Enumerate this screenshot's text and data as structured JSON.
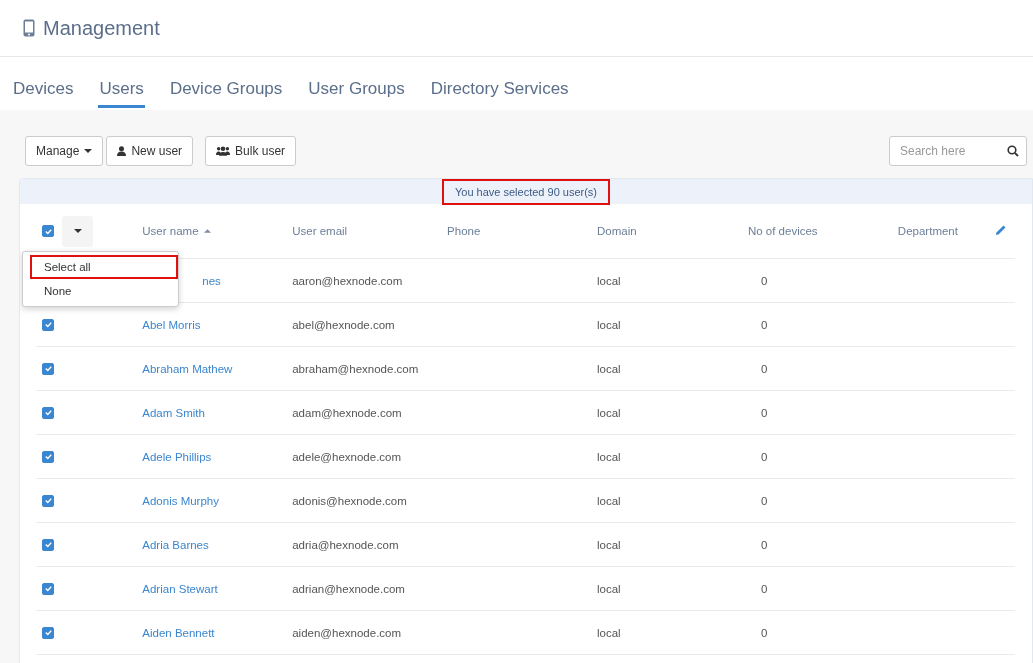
{
  "page": {
    "title": "Management"
  },
  "tabs": [
    {
      "label": "Devices",
      "selected": false
    },
    {
      "label": "Users",
      "selected": true
    },
    {
      "label": "Device Groups",
      "selected": false
    },
    {
      "label": "User Groups",
      "selected": false
    },
    {
      "label": "Directory Services",
      "selected": false
    }
  ],
  "toolbar": {
    "buttons": [
      {
        "label": "Manage",
        "kind": "dropdown"
      },
      {
        "label": "New user",
        "kind": "user"
      },
      {
        "label": "Bulk user",
        "kind": "users"
      }
    ],
    "search": {
      "placeholder": "Search here"
    }
  },
  "banner": {
    "text": "You have selected 90 user(s)",
    "highlighted": true
  },
  "table": {
    "select_all_checked": true,
    "columns": [
      {
        "label": "User name",
        "sorted": true
      },
      {
        "label": "User email",
        "sorted": false
      },
      {
        "label": "Phone",
        "sorted": false
      },
      {
        "label": "Domain",
        "sorted": false
      },
      {
        "label": "No of devices",
        "sorted": false
      },
      {
        "label": "Department",
        "sorted": false
      }
    ],
    "rows": [
      {
        "name": "nes",
        "email": "aaron@hexnode.com",
        "domain": "local",
        "devices": "0",
        "kind": "covered"
      },
      {
        "name": "Abel Morris",
        "email": "abel@hexnode.com",
        "domain": "local",
        "devices": "0",
        "checked": true,
        "kind": "row"
      },
      {
        "name": "Abraham Mathew",
        "email": "abraham@hexnode.com",
        "domain": "local",
        "devices": "0",
        "checked": true,
        "kind": "row"
      },
      {
        "name": "Adam Smith",
        "email": "adam@hexnode.com",
        "domain": "local",
        "devices": "0",
        "checked": true,
        "kind": "row"
      },
      {
        "name": "Adele Phillips",
        "email": "adele@hexnode.com",
        "domain": "local",
        "devices": "0",
        "checked": true,
        "kind": "row"
      },
      {
        "name": "Adonis Murphy",
        "email": "adonis@hexnode.com",
        "domain": "local",
        "devices": "0",
        "checked": true,
        "kind": "row"
      },
      {
        "name": "Adria Barnes",
        "email": "adria@hexnode.com",
        "domain": "local",
        "devices": "0",
        "checked": true,
        "kind": "row"
      },
      {
        "name": "Adrian Stewart",
        "email": "adrian@hexnode.com",
        "domain": "local",
        "devices": "0",
        "checked": true,
        "kind": "row"
      },
      {
        "name": "Aiden Bennett",
        "email": "aiden@hexnode.com",
        "domain": "local",
        "devices": "0",
        "checked": true,
        "kind": "row"
      }
    ]
  },
  "select_menu": {
    "items": [
      {
        "label": "Select all",
        "highlighted": true
      },
      {
        "label": "None",
        "highlighted": false
      }
    ]
  }
}
